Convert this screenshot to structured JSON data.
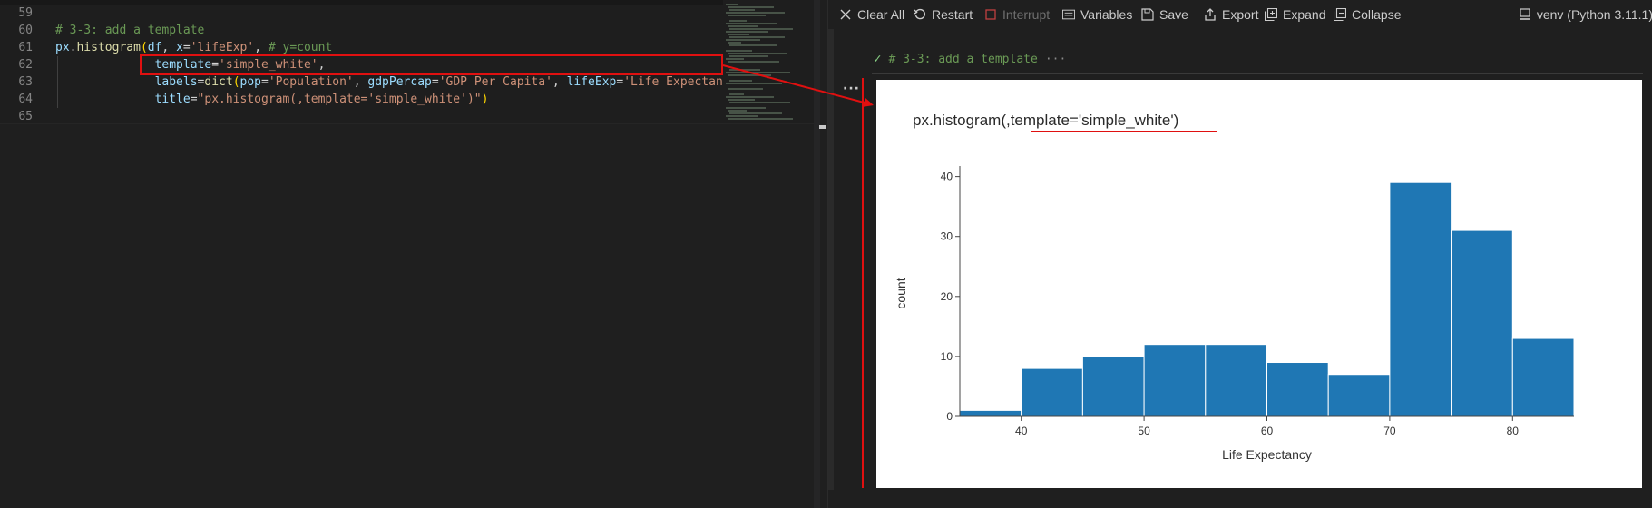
{
  "editor": {
    "lines": [
      {
        "num": "59",
        "indent": false,
        "tokens": []
      },
      {
        "num": "60",
        "indent": false,
        "tokens": [
          {
            "t": "# 3-3: add a template",
            "c": "comment"
          }
        ]
      },
      {
        "num": "61",
        "indent": false,
        "tokens": [
          {
            "t": "px",
            "c": "ident"
          },
          {
            "t": ".",
            "c": "punc"
          },
          {
            "t": "histogram",
            "c": "func"
          },
          {
            "t": "(",
            "c": "paren"
          },
          {
            "t": "df",
            "c": "ident"
          },
          {
            "t": ", ",
            "c": "punc"
          },
          {
            "t": "x",
            "c": "ident"
          },
          {
            "t": "=",
            "c": "punc"
          },
          {
            "t": "'lifeExp'",
            "c": "str"
          },
          {
            "t": ", ",
            "c": "punc"
          },
          {
            "t": "# y=count",
            "c": "comment"
          }
        ]
      },
      {
        "num": "62",
        "indent": true,
        "tokens": [
          {
            "t": "              ",
            "c": "punc"
          },
          {
            "t": "template",
            "c": "ident"
          },
          {
            "t": "=",
            "c": "punc"
          },
          {
            "t": "'simple_white'",
            "c": "str"
          },
          {
            "t": ",",
            "c": "punc"
          }
        ]
      },
      {
        "num": "63",
        "indent": true,
        "tokens": [
          {
            "t": "              ",
            "c": "punc"
          },
          {
            "t": "labels",
            "c": "ident"
          },
          {
            "t": "=",
            "c": "punc"
          },
          {
            "t": "dict",
            "c": "func"
          },
          {
            "t": "(",
            "c": "paren"
          },
          {
            "t": "pop",
            "c": "ident"
          },
          {
            "t": "=",
            "c": "punc"
          },
          {
            "t": "'Population'",
            "c": "str"
          },
          {
            "t": ", ",
            "c": "punc"
          },
          {
            "t": "gdpPercap",
            "c": "ident"
          },
          {
            "t": "=",
            "c": "punc"
          },
          {
            "t": "'GDP Per Capita'",
            "c": "str"
          },
          {
            "t": ", ",
            "c": "punc"
          },
          {
            "t": "lifeExp",
            "c": "ident"
          },
          {
            "t": "=",
            "c": "punc"
          },
          {
            "t": "'Life Expectancy",
            "c": "str"
          }
        ]
      },
      {
        "num": "64",
        "indent": true,
        "tokens": [
          {
            "t": "              ",
            "c": "punc"
          },
          {
            "t": "title",
            "c": "ident"
          },
          {
            "t": "=",
            "c": "punc"
          },
          {
            "t": "\"px.histogram(,template='simple_white')\"",
            "c": "str"
          },
          {
            "t": ")",
            "c": "paren"
          }
        ]
      },
      {
        "num": "65",
        "indent": false,
        "tokens": []
      }
    ]
  },
  "toolbar": {
    "clear_all": "Clear All",
    "restart": "Restart",
    "interrupt": "Interrupt",
    "variables": "Variables",
    "save": "Save",
    "export": "Export",
    "expand": "Expand",
    "collapse": "Collapse",
    "kernel": "venv (Python 3.11.1)"
  },
  "cell": {
    "status_glyph": "✓",
    "title": "# 3-3: add a template",
    "more": "···",
    "menu_glyph": "···"
  },
  "colors": {
    "bar": "#1f77b4",
    "annotation_red": "#e01010"
  },
  "chart_data": {
    "type": "bar",
    "title": "px.histogram(,template='simple_white')",
    "xlabel": "Life Expectancy",
    "ylabel": "count",
    "bin_edges": [
      35,
      40,
      45,
      50,
      55,
      60,
      65,
      70,
      75,
      80,
      85
    ],
    "values": [
      1,
      8,
      10,
      12,
      12,
      9,
      7,
      39,
      31,
      13
    ],
    "xlim": [
      35,
      85
    ],
    "ylim": [
      0,
      41
    ],
    "xticks": [
      40,
      50,
      60,
      70,
      80
    ],
    "yticks": [
      0,
      10,
      20,
      30,
      40
    ],
    "grid": false,
    "template": "simple_white"
  }
}
